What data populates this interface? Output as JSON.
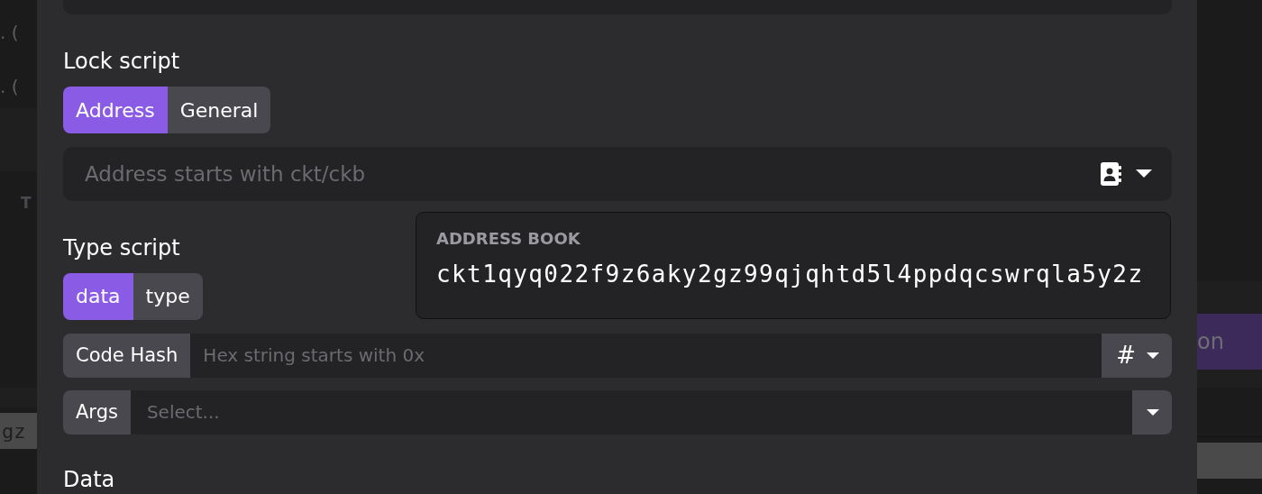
{
  "background": {
    "left_rows": [
      ". (",
      ". ("
    ],
    "column_header": "T",
    "bottom_text": "gz",
    "action_button": "on"
  },
  "lock_script": {
    "label": "Lock script",
    "tabs": [
      {
        "label": "Address",
        "selected": true
      },
      {
        "label": "General",
        "selected": false
      }
    ],
    "address_field": {
      "placeholder": "Address starts with ckt/ckb"
    }
  },
  "address_book": {
    "title": "ADDRESS BOOK",
    "items": [
      "ckt1qyq022f9z6aky2gz99qjqhtd5l4ppdqcswrqla5y2z"
    ]
  },
  "type_script": {
    "label": "Type script",
    "tabs": [
      {
        "label": "data",
        "selected": true
      },
      {
        "label": "type",
        "selected": false
      }
    ],
    "code_hash": {
      "label": "Code Hash",
      "placeholder": "Hex string starts with 0x",
      "button": "#"
    },
    "args": {
      "label": "Args",
      "placeholder": "Select..."
    }
  },
  "data_label": "Data"
}
